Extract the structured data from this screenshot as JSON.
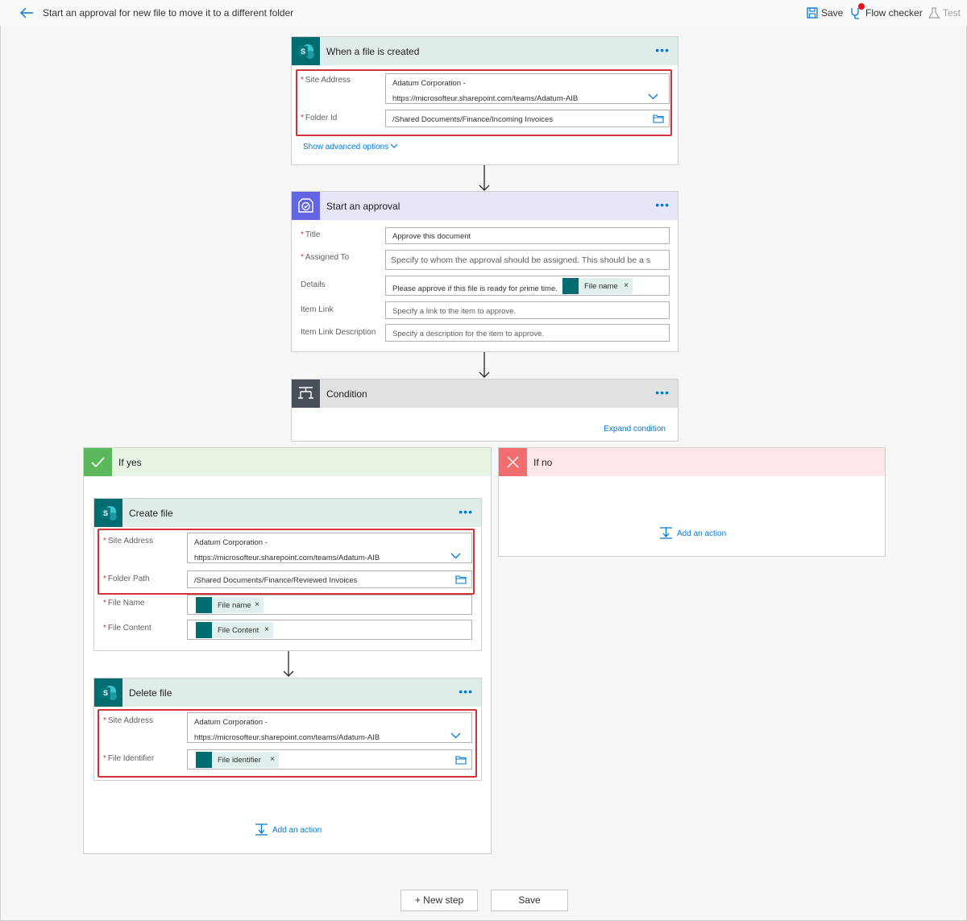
{
  "header": {
    "title": "Start an approval for new file to move it to a different folder",
    "save_label": "Save",
    "flow_checker_label": "Flow checker",
    "test_label": "Test"
  },
  "trigger": {
    "title": "When a file is created",
    "site_address_label": "Site Address",
    "site_address_line1": "Adatum Corporation -",
    "site_address_line2": "https://microsofteur.sharepoint.com/teams/Adatum-AIB",
    "folder_id_label": "Folder Id",
    "folder_id_value": "/Shared Documents/Finance/Incoming Invoices",
    "advanced_options": "Show advanced options"
  },
  "approval": {
    "title": "Start an approval",
    "title_label": "Title",
    "title_value": "Approve this document",
    "assigned_label": "Assigned To",
    "assigned_placeholder": "Specify to whom the approval should be assigned. This should be a s",
    "details_label": "Details",
    "details_value": "Please approve if this file is ready for prime time.",
    "details_token": "File name",
    "item_link_label": "Item Link",
    "item_link_placeholder": "Specify a link to the item to approve.",
    "item_link_desc_label": "Item Link Description",
    "item_link_desc_placeholder": "Specify a description for the item to approve."
  },
  "condition": {
    "title": "Condition",
    "expand_label": "Expand condition"
  },
  "if_yes": {
    "title": "If yes",
    "add_action": "Add an action",
    "create_file": {
      "title": "Create file",
      "site_address_label": "Site Address",
      "site_address_line1": "Adatum Corporation -",
      "site_address_line2": "https://microsofteur.sharepoint.com/teams/Adatum-AIB",
      "folder_path_label": "Folder Path",
      "folder_path_value": "/Shared Documents/Finance/Reviewed Invoices",
      "file_name_label": "File Name",
      "file_name_token": "File name",
      "file_content_label": "File Content",
      "file_content_token": "File Content"
    },
    "delete_file": {
      "title": "Delete file",
      "site_address_label": "Site Address",
      "site_address_line1": "Adatum Corporation -",
      "site_address_line2": "https://microsofteur.sharepoint.com/teams/Adatum-AIB",
      "file_identifier_label": "File Identifier",
      "file_identifier_token": "File identifier"
    }
  },
  "if_no": {
    "title": "If no",
    "add_action": "Add an action"
  },
  "footer": {
    "new_step": "+ New step",
    "save": "Save"
  },
  "colors": {
    "accent": "#0078d4",
    "sharepoint": "#036c70",
    "approval": "#5c2d91",
    "condition": "#484f58",
    "highlight": "#d13438",
    "yes": "#5cb85c",
    "no": "#f26d6d"
  }
}
